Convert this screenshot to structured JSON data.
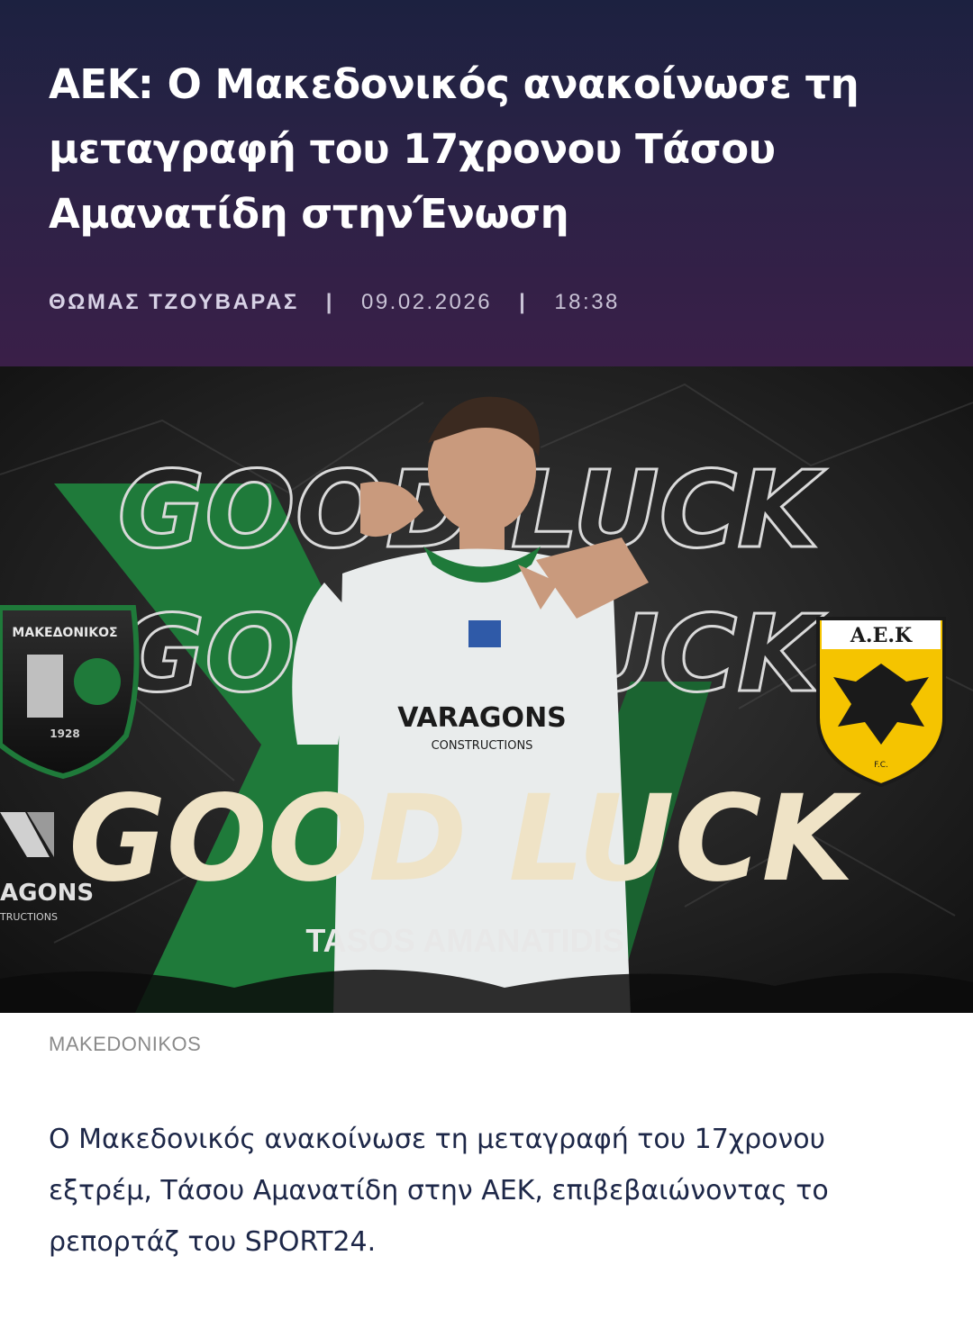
{
  "article": {
    "headline": "ΑΕΚ: Ο Μακεδονικός ανακοίνωσε τη μεταγραφή του 17χρονου Τάσου Αμανατίδη στηνΈνωση",
    "author": "ΘΩΜΑΣ ΤΖΟΥΒΑΡΑΣ",
    "separator": "|",
    "date": "09.02.2026",
    "time": "18:38",
    "image_caption": "MAKEDONIKOS",
    "lede": "Ο Μακεδονικός ανακοίνωσε τη μεταγραφή του 17χρονου εξτρέμ, Τάσου Αμανατίδη στην ΑΕΚ, επιβεβαιώνοντας το ρεπορτάζ του SPORT24."
  },
  "image": {
    "good_luck": "GOOD LUCK",
    "player_name": "TASOS AMANATIDIS",
    "sponsor_name": "VARAGONS",
    "sponsor_sub": "CONSTRUCTIONS",
    "left_sponsor_name": "AGONS",
    "left_sponsor_sub": "TRUCTIONS",
    "left_club_name": "ΜΑΚΕΔΟΝΙΚΟΣ",
    "left_club_year": "1928",
    "right_club_name": "Α.Ε.Κ",
    "right_club_tag": "F.C.",
    "colors": {
      "green": "#1f7a3a",
      "cream": "#efe3c6",
      "yellow": "#f5c400"
    }
  }
}
